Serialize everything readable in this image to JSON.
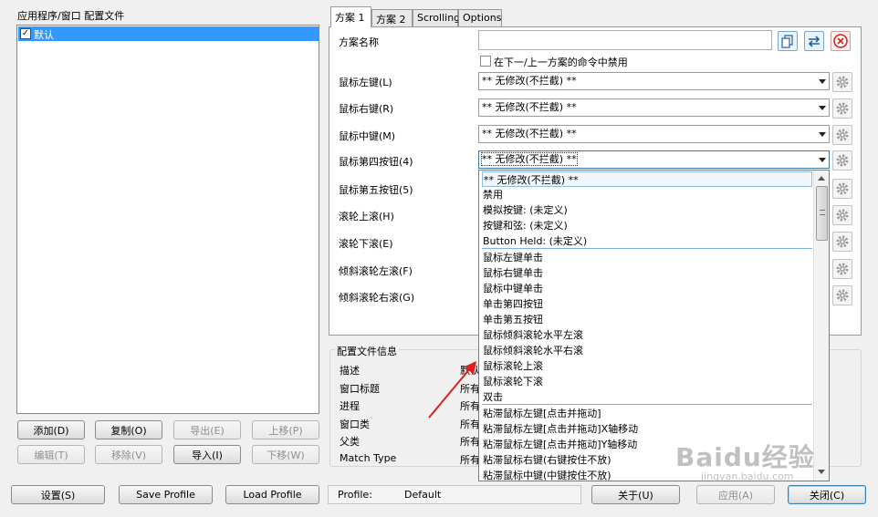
{
  "profiles_panel": {
    "header": "应用程序/窗口 配置文件",
    "items": [
      {
        "label": "默认",
        "checked": true
      }
    ]
  },
  "left_buttons": {
    "add": "添加(D)",
    "copy": "复制(O)",
    "export": "导出(E)",
    "move_up": "上移(P)",
    "edit": "编辑(T)",
    "remove": "移除(V)",
    "import": "导入(I)",
    "move_down": "下移(W)"
  },
  "tabs": [
    "方案 1",
    "方案 2",
    "Scrolling",
    "Options"
  ],
  "scheme": {
    "name_label": "方案名称",
    "name_value": "",
    "disable_checkbox_label": "在下一/上一方案的命令中禁用",
    "rows": [
      {
        "label": "鼠标左键(L)",
        "value": "** 无修改(不拦截) **"
      },
      {
        "label": "鼠标右键(R)",
        "value": "** 无修改(不拦截) **"
      },
      {
        "label": "鼠标中键(M)",
        "value": "** 无修改(不拦截) **"
      },
      {
        "label": "鼠标第四按钮(4)",
        "value": "** 无修改(不拦截) **"
      },
      {
        "label": "鼠标第五按钮(5)",
        "value": ""
      },
      {
        "label": "滚轮上滚(H)",
        "value": ""
      },
      {
        "label": "滚轮下滚(E)",
        "value": ""
      },
      {
        "label": "倾斜滚轮左滚(F)",
        "value": ""
      },
      {
        "label": "倾斜滚轮右滚(G)",
        "value": ""
      }
    ]
  },
  "dropdown_options": [
    "** 无修改(不拦截) **",
    "禁用",
    "模拟按键: (未定义)",
    "按键和弦: (未定义)",
    "Button Held: (未定义)",
    "鼠标左键单击",
    "鼠标右键单击",
    "鼠标中键单击",
    "单击第四按钮",
    "单击第五按钮",
    "鼠标倾斜滚轮水平左滚",
    "鼠标倾斜滚轮水平右滚",
    "鼠标滚轮上滚",
    "鼠标滚轮下滚",
    "双击",
    "粘滞鼠标左键[点击并拖动]",
    "粘滞鼠标左键[点击并拖动]X轴移动",
    "粘滞鼠标左键[点击并拖动]Y轴移动",
    "粘滞鼠标右键(右键按住不放)",
    "粘滞鼠标中键(中键按住不放)"
  ],
  "profile_info": {
    "title": "配置文件信息",
    "rows": [
      {
        "label": "描述",
        "value": "默认"
      },
      {
        "label": "窗口标题",
        "value": "所有"
      },
      {
        "label": "进程",
        "value": "所有"
      },
      {
        "label": "窗口类",
        "value": "所有"
      },
      {
        "label": "父类",
        "value": "所有"
      },
      {
        "label": "Match Type",
        "value": "所有"
      }
    ]
  },
  "bottom_bar": {
    "settings": "设置(S)",
    "save_profile": "Save Profile",
    "load_profile": "Load Profile",
    "profile_label": "Profile:",
    "profile_value": "Default",
    "about": "关于(U)",
    "apply": "应用(A)",
    "close": "关闭(C)"
  },
  "watermark": {
    "brand": "Baidu经验",
    "url": "jingyan.baidu.com"
  },
  "colors": {
    "selection": "#3399ff",
    "annotation_arrow": "#e02020"
  }
}
